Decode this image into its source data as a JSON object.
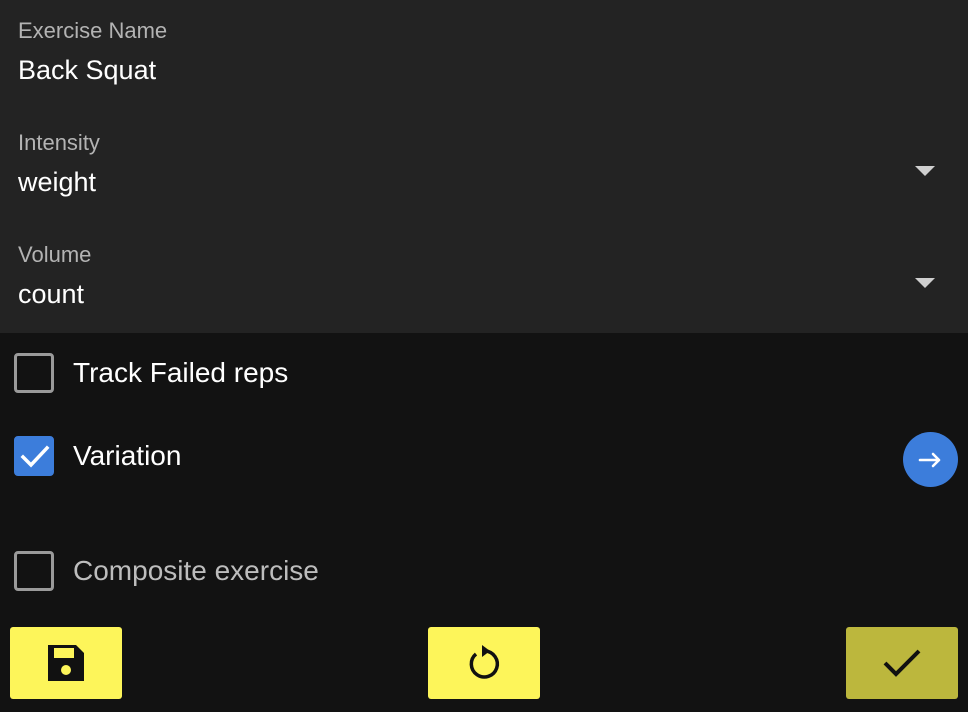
{
  "form": {
    "exercise_name": {
      "label": "Exercise Name",
      "value": "Back Squat"
    },
    "intensity": {
      "label": "Intensity",
      "value": "weight"
    },
    "volume": {
      "label": "Volume",
      "value": "count"
    }
  },
  "options": {
    "track_failed_reps": {
      "label": "Track Failed reps",
      "checked": false
    },
    "variation": {
      "label": "Variation",
      "checked": true
    },
    "composite_exercise": {
      "label": "Composite exercise",
      "checked": false
    }
  },
  "icons": {
    "dropdown": "chevron-down-icon",
    "check": "check-icon",
    "arrow": "arrow-right-icon",
    "save": "floppy-disk-icon",
    "reset": "rotate-icon",
    "confirm": "check-icon"
  },
  "colors": {
    "accent_blue": "#3c7ddb",
    "button_yellow": "#fdf55a",
    "button_yellow_dim": "#bcb73d",
    "panel": "#232323",
    "background": "#121212"
  }
}
